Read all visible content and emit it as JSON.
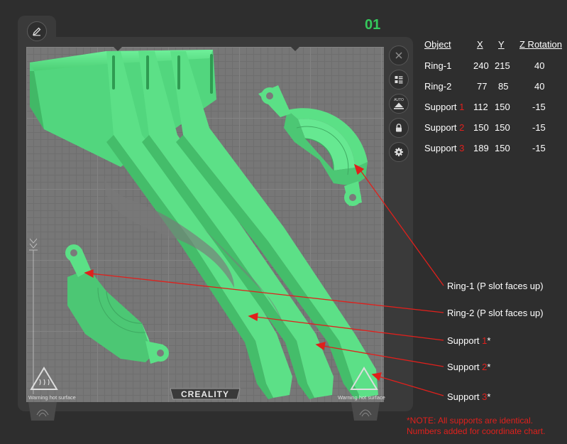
{
  "plate": {
    "number": "01",
    "brand": "CREALITY",
    "warning": "Warning hot surface",
    "auto_label": "AUTO"
  },
  "table": {
    "headers": {
      "object": "Object",
      "x": "X",
      "y": "Y",
      "rot": "Z Rotation"
    },
    "rows": [
      {
        "name": "Ring-1",
        "num": "",
        "x": "240",
        "y": "215",
        "rot": "40"
      },
      {
        "name": "Ring-2",
        "num": "",
        "x": "77",
        "y": "85",
        "rot": "40"
      },
      {
        "name": "Support ",
        "num": "1",
        "x": "112",
        "y": "150",
        "rot": "-15"
      },
      {
        "name": "Support ",
        "num": "2",
        "x": "150",
        "y": "150",
        "rot": "-15"
      },
      {
        "name": "Support ",
        "num": "3",
        "x": "189",
        "y": "150",
        "rot": "-15"
      }
    ]
  },
  "callouts": {
    "ring1": "Ring-1 (P slot faces up)",
    "ring2": "Ring-2 (P slot faces up)",
    "support1": {
      "prefix": "Support ",
      "num": "1",
      "suffix": "*"
    },
    "support2": {
      "prefix": "Support ",
      "num": "2",
      "suffix": "*"
    },
    "support3": {
      "prefix": "Support ",
      "num": "3",
      "suffix": "*"
    }
  },
  "note": {
    "line1": "*NOTE: All supports are identical.",
    "line2": "Numbers added for coordinate chart."
  },
  "colors": {
    "accent": "#35c85c",
    "model": "#62e38a",
    "annotation": "#e0201c"
  }
}
